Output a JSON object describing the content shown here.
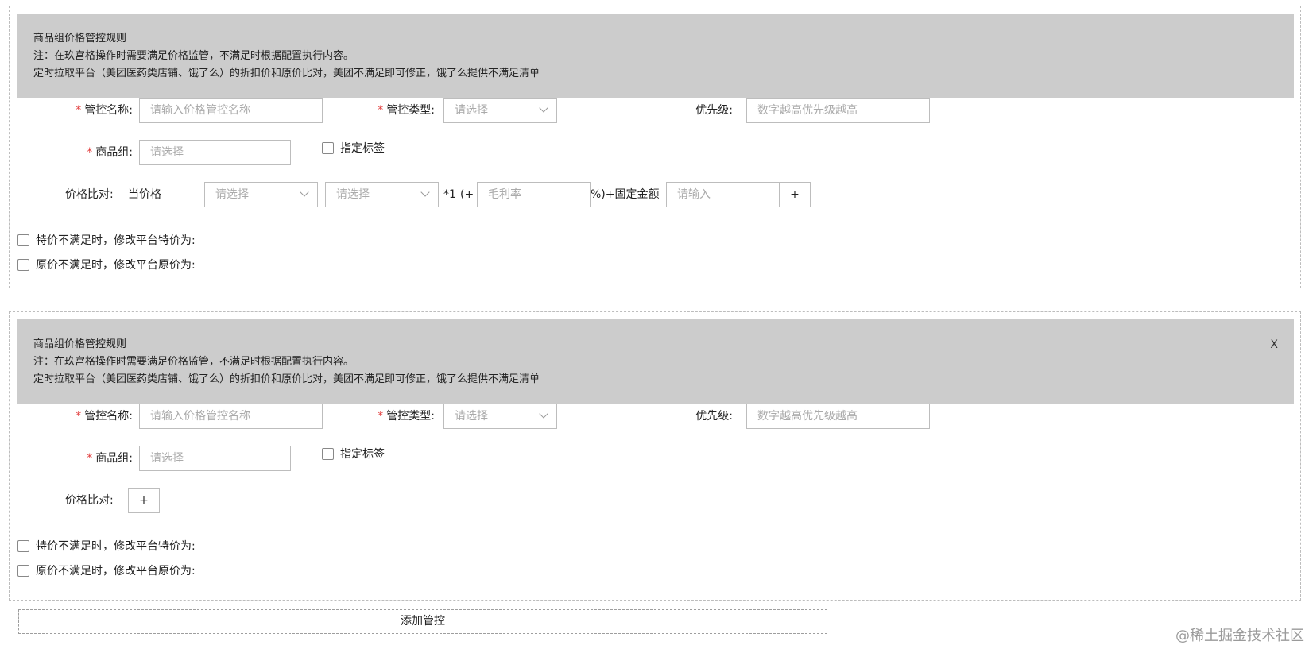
{
  "rules": [
    {
      "banner": {
        "title": "商品组价格管控规则",
        "note1": "注：在玖宫格操作时需要满足价格监管，不满足时根据配置执行内容。",
        "note2": "定时拉取平台（美团医药类店铺、饿了么）的折扣价和原价比对，美团不满足即可修正，饿了么提供不满足清单",
        "close": ""
      },
      "name_label": "管控名称:",
      "name_placeholder": "请输入价格管控名称",
      "type_label": "管控类型:",
      "type_placeholder": "请选择",
      "priority_label": "优先级:",
      "priority_placeholder": "数字越高优先级越高",
      "group_label": "商品组:",
      "group_placeholder": "请选择",
      "tag_label": "指定标签",
      "compare_label": "价格比对:",
      "compare_row": {
        "current": "当价格",
        "select1": "请选择",
        "select2": "请选择",
        "mult": "*1",
        "paren": "(+",
        "margin_placeholder": "毛利率",
        "suffix": "%)+固定金额",
        "amount_placeholder": "请输入",
        "plus": "+"
      },
      "special_label": "特价不满足时，修改平台特价为:",
      "original_label": "原价不满足时，修改平台原价为:"
    },
    {
      "banner": {
        "title": "商品组价格管控规则",
        "note1": "注：在玖宫格操作时需要满足价格监管，不满足时根据配置执行内容。",
        "note2": "定时拉取平台（美团医药类店铺、饿了么）的折扣价和原价比对，美团不满足即可修正，饿了么提供不满足清单",
        "close": "X"
      },
      "name_label": "管控名称:",
      "name_placeholder": "请输入价格管控名称",
      "type_label": "管控类型:",
      "type_placeholder": "请选择",
      "priority_label": "优先级:",
      "priority_placeholder": "数字越高优先级越高",
      "group_label": "商品组:",
      "group_placeholder": "请选择",
      "tag_label": "指定标签",
      "compare_label": "价格比对:",
      "compare_plus": "+",
      "special_label": "特价不满足时，修改平台特价为:",
      "original_label": "原价不满足时，修改平台原价为:"
    }
  ],
  "add_button": "添加管控",
  "watermark": "@稀土掘金技术社区",
  "colors": {
    "banner_bg": "#cccccc",
    "required": "#e23c3c",
    "border": "#bdbdbd"
  }
}
